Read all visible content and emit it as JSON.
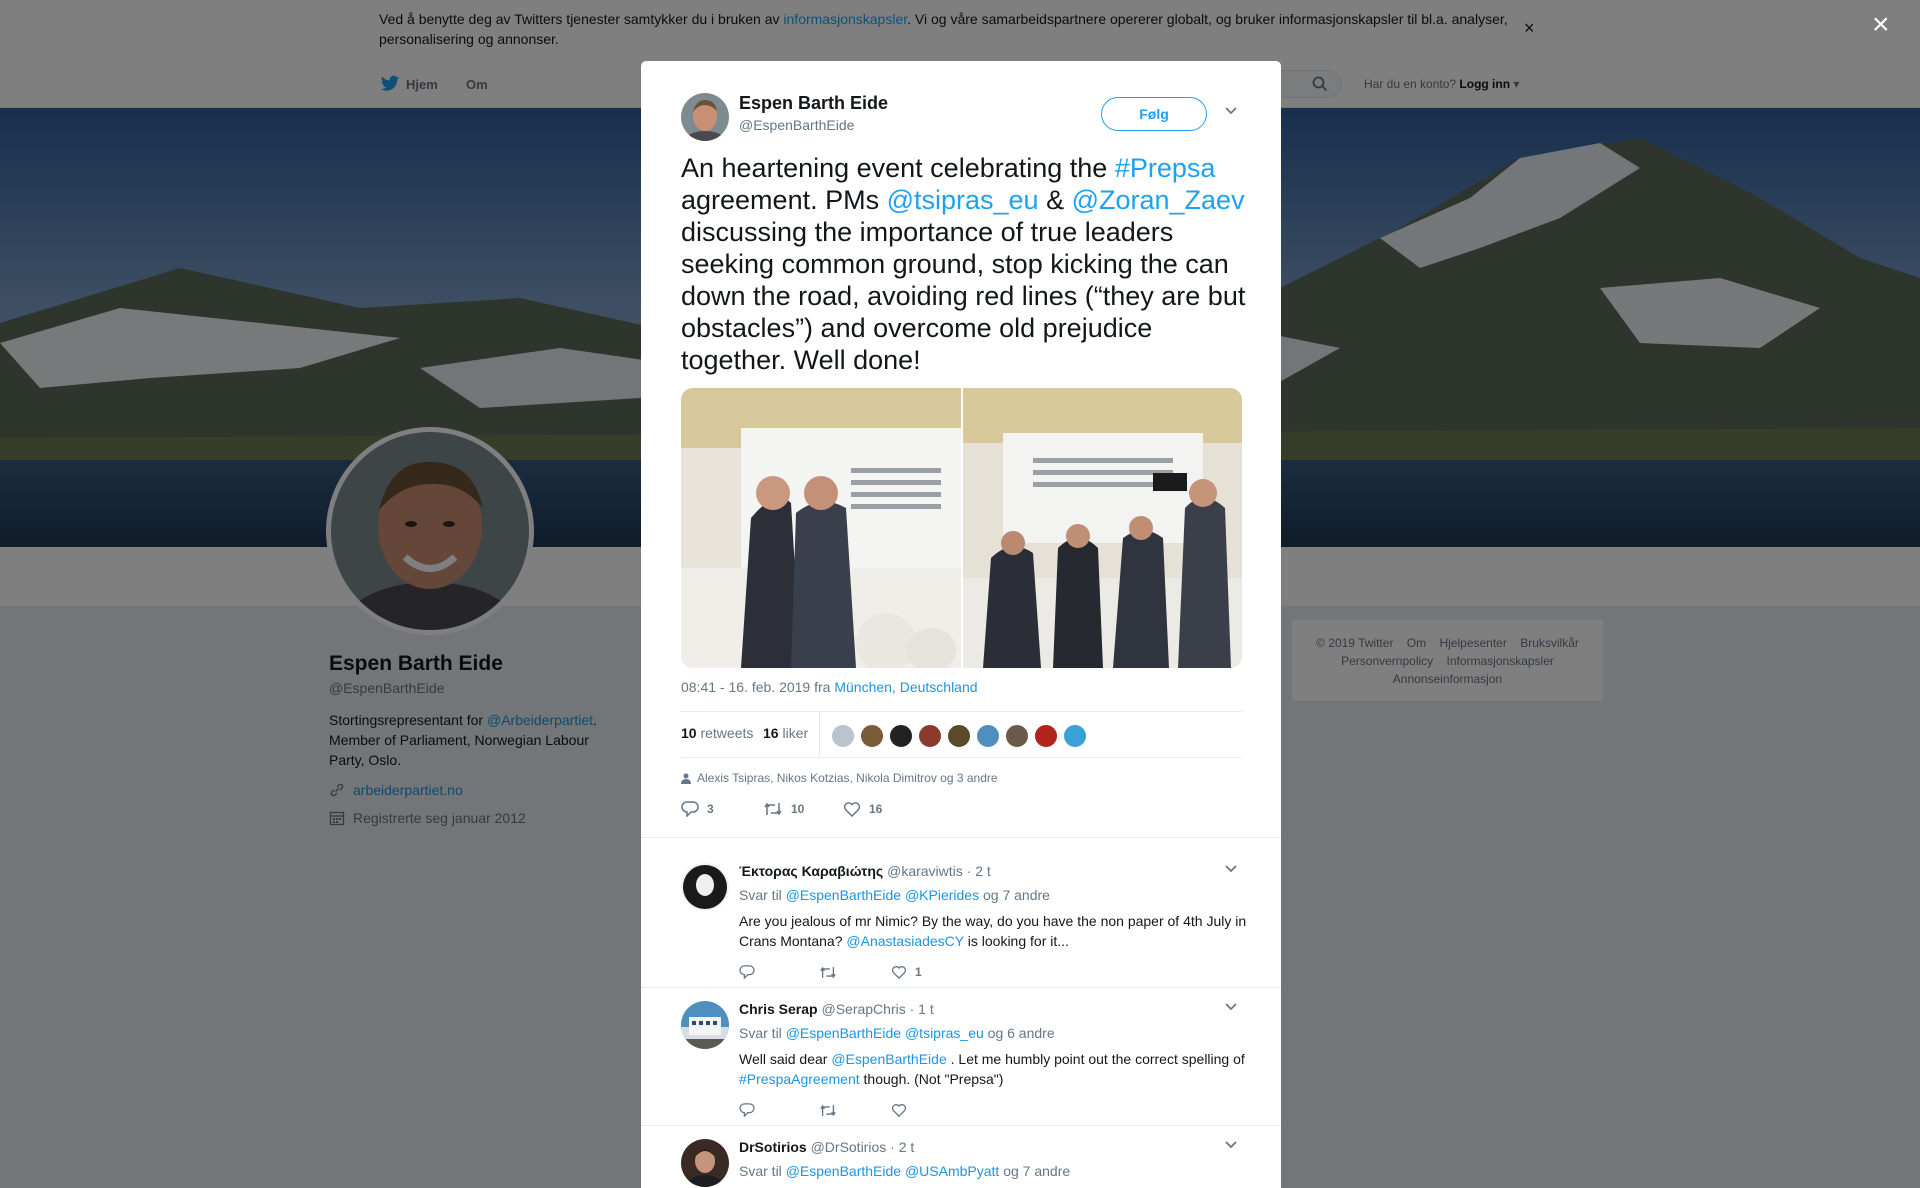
{
  "cookie_bar": {
    "text_before": "Ved å benytte deg av Twitters tjenester samtykker du i bruken av ",
    "link": "informasjonskapsler",
    "text_after": ". Vi og våre samarbeidspartnere opererer globalt, og bruker informasjonskapsler til bl.a. analyser, personalisering og annonser.",
    "close": "×"
  },
  "nav": {
    "home": "Hjem",
    "about": "Om",
    "account_prompt": "Har du en konto?",
    "login": "Logg inn"
  },
  "profile": {
    "name": "Espen Barth Eide",
    "handle": "@EspenBarthEide",
    "bio_before": "Stortingsrepresentant for ",
    "bio_link": "@Arbeiderpartiet",
    "bio_after": ". Member of Parliament, Norwegian Labour Party, Oslo.",
    "url": "arbeiderpartiet.no",
    "joined": "Registrerte seg januar 2012"
  },
  "footer": {
    "links": [
      "© 2019 Twitter",
      "Om",
      "Hjelpesenter",
      "Bruksvilkår",
      "Personvernpolicy",
      "Informasjonskapsler",
      "Annonseinformasjon"
    ]
  },
  "overlay": {
    "close": "×"
  },
  "tweet": {
    "name": "Espen Barth Eide",
    "handle": "@EspenBarthEide",
    "follow": "Følg",
    "text_1": "An heartening event celebrating the ",
    "tag_1": "#Prepsa",
    "text_2": " agreement. PMs ",
    "mention_1": "@tsipras_eu",
    "text_3": " & ",
    "mention_2": "@Zoran_Zaev",
    "text_4": " discussing the importance of true leaders seeking common ground, stop kicking the can down the road, avoiding red lines (“they are but obstacles”) and overcome old prejudice together. Well done!",
    "time": "08:41 - 16. feb. 2019 fra ",
    "location": "München, Deutschland",
    "retweets_count": "10",
    "retweets_label": "retweets",
    "likes_count": "16",
    "likes_label": "liker",
    "liked_by": "Alexis Tsipras, Nikos Kotzias, Nikola Dimitrov og 3 andre",
    "reply_count": "3",
    "retweet_count": "10",
    "like_count": "16",
    "liker_colors": [
      "#b8c4ce",
      "#7a5b3a",
      "#222222",
      "#8a3b2e",
      "#5a4a2a",
      "#4f8fc0",
      "#6a5a4a",
      "#b0241c",
      "#3aa0d8"
    ]
  },
  "replies": [
    {
      "name": "Έκτορας Καραβιώτης",
      "handle": "@karaviwtis",
      "time": "· 2 t",
      "reply_to_label": "Svar til ",
      "reply_to_1": "@EspenBarthEide",
      "reply_to_2": "@KPierides",
      "reply_to_more": "og 7 andre",
      "body_1": "Are you jealous of mr Nimic? By the way, do you have the non paper of 4th July in Crans Montana? ",
      "body_link": "@AnastasiadesCY",
      "body_2": " is looking for it...",
      "likes": "1"
    },
    {
      "name": "Chris Serap",
      "handle": "@SerapChris",
      "time": "· 1 t",
      "reply_to_label": "Svar til ",
      "reply_to_1": "@EspenBarthEide",
      "reply_to_2": "@tsipras_eu",
      "reply_to_more": "og 6 andre",
      "body_1": "Well said dear ",
      "body_link": "@EspenBarthEide",
      "body_2": " . Let me humbly point out the correct spelling of ",
      "body_link_2": "#PrespaAgreement",
      "body_3": " though. (Not \"Prepsa\")"
    },
    {
      "name": "DrSotirios",
      "handle": "@DrSotirios",
      "time": "· 2 t",
      "reply_to_label": "Svar til ",
      "reply_to_1": "@EspenBarthEide",
      "reply_to_2": "@USAmbPyatt",
      "reply_to_more": "og 7 andre"
    }
  ]
}
